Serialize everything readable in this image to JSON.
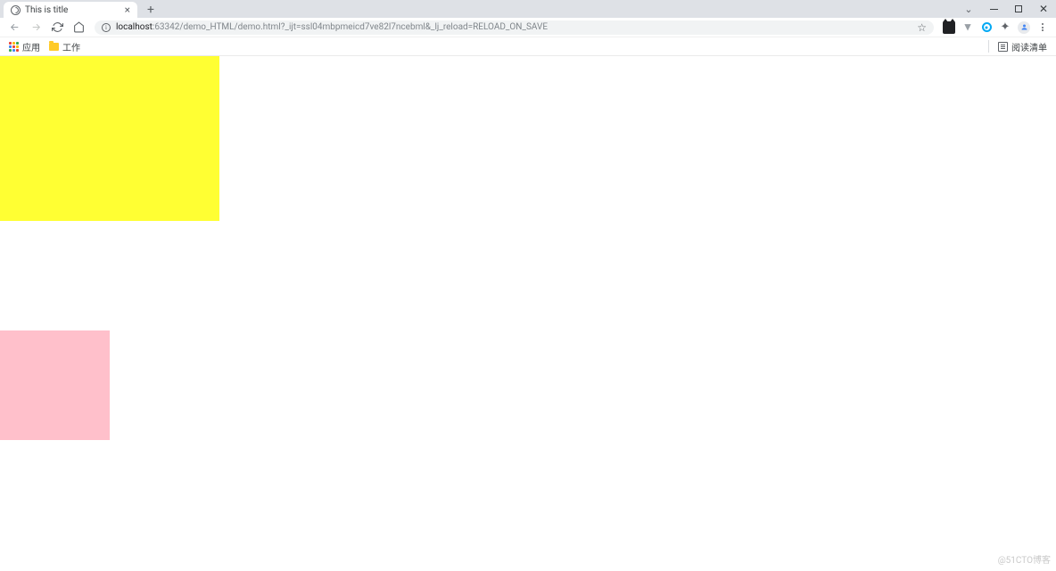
{
  "tab": {
    "title": "This is title"
  },
  "address": {
    "host": "localhost",
    "rest": ":63342/demo_HTML/demo.html?_ijt=ssl04mbpmeicd7ve82l7ncebml&_lj_reload=RELOAD_ON_SAVE"
  },
  "bookmarks": {
    "apps": "应用",
    "work_folder": "工作",
    "reading_list": "阅读清单"
  },
  "content": {
    "yellow_box_color": "#ffff33",
    "pink_box_color": "#ffc0cb"
  },
  "watermark": "@51CTO博客"
}
